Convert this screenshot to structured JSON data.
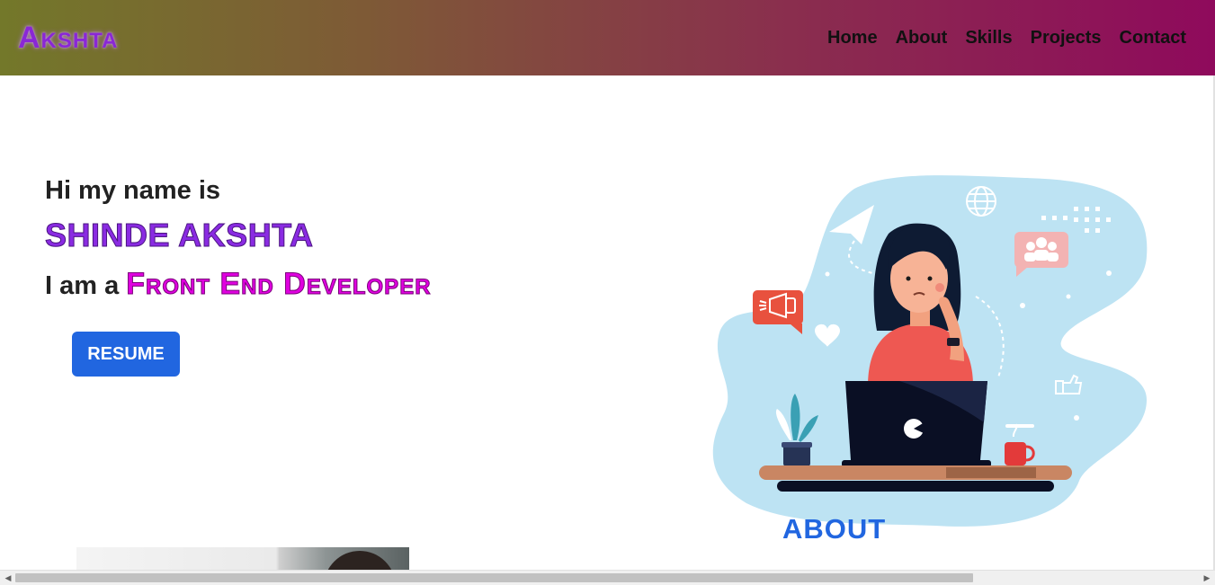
{
  "header": {
    "logo": "Akshta",
    "nav": [
      {
        "label": "Home"
      },
      {
        "label": "About"
      },
      {
        "label": "Skills"
      },
      {
        "label": "Projects"
      },
      {
        "label": "Contact"
      }
    ]
  },
  "hero": {
    "greeting": "Hi my name is",
    "name": "SHINDE AKSHTA",
    "role_prefix": "I am a",
    "role_title": "Front End Developer",
    "resume_label": "RESUME"
  },
  "about": {
    "heading": "ABOUT"
  },
  "colors": {
    "accent_blue": "#2166e0",
    "name_purple": "#8a2be2",
    "role_magenta": "#e000e0",
    "illustration_blob": "#bde3f3"
  }
}
